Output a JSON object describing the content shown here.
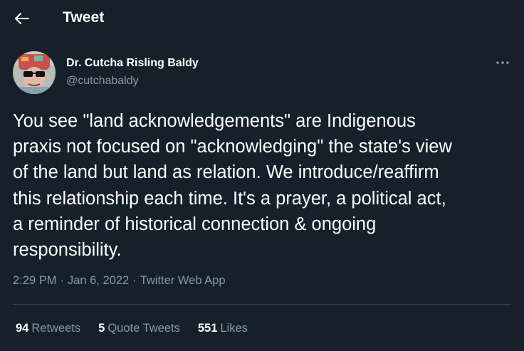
{
  "header": {
    "title": "Tweet",
    "back_icon": "arrow-left-icon"
  },
  "author": {
    "display_name": "Dr. Cutcha Risling Baldy",
    "handle": "@cutchabaldy",
    "more_icon": "more-horizontal-icon"
  },
  "tweet": {
    "text": "You see \"land acknowledgements\" are Indigenous\npraxis not focused on \"acknowledging\" the state's view\nof the land but land as relation. We introduce/reaffirm\nthis relationship each time. It's a prayer, a political act,\na reminder of historical connection & ongoing\nresponsibility.",
    "time": "2:29 PM",
    "separator": "·",
    "date": "Jan 6, 2022",
    "source": "Twitter Web App"
  },
  "stats": {
    "retweets": {
      "count": "94",
      "label": "Retweets"
    },
    "quotes": {
      "count": "5",
      "label": "Quote Tweets"
    },
    "likes": {
      "count": "551",
      "label": "Likes"
    }
  },
  "colors": {
    "background": "#15202b",
    "text_primary": "#ffffff",
    "text_secondary": "#8b98a5",
    "divider": "#38444d"
  }
}
